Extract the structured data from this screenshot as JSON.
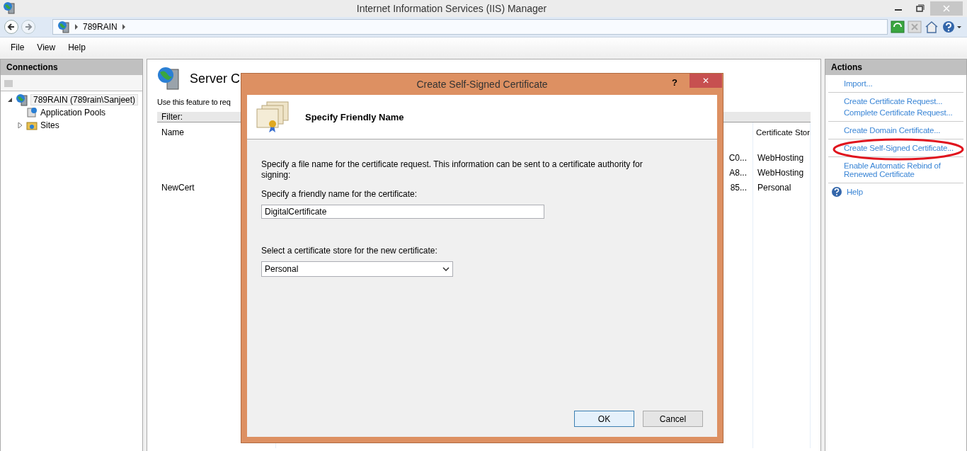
{
  "window": {
    "title": "Internet Information Services (IIS) Manager"
  },
  "address": {
    "path": [
      "789RAIN"
    ]
  },
  "menu": [
    "File",
    "View",
    "Help"
  ],
  "connections": {
    "title": "Connections",
    "tree": [
      {
        "label": "789RAIN (789rain\\Sanjeet)",
        "selected": true,
        "expanded": true,
        "children": [
          {
            "label": "Application Pools",
            "kind": "pools",
            "selected": false
          },
          {
            "label": "Sites",
            "kind": "sites",
            "selected": false,
            "expanded": false
          }
        ]
      }
    ]
  },
  "feature": {
    "title": "Server C",
    "description": "Use this feature to req",
    "filter_label": "Filter:",
    "columns": [
      "Name",
      "Certificate Stor"
    ],
    "rows": [
      {
        "name": "",
        "column_2": "C0...",
        "store": "WebHosting"
      },
      {
        "name": "",
        "column_2": "A8...",
        "store": "WebHosting"
      },
      {
        "name": "NewCert",
        "column_2": "85...",
        "store": "Personal"
      }
    ]
  },
  "actions": {
    "title": "Actions",
    "groups": [
      [
        {
          "label": "Import...",
          "kind": "link",
          "highlighted": false
        }
      ],
      [
        {
          "label": "Create Certificate Request...",
          "kind": "link",
          "highlighted": false
        },
        {
          "label": "Complete Certificate Request...",
          "kind": "link",
          "highlighted": false
        }
      ],
      [
        {
          "label": "Create Domain Certificate...",
          "kind": "link",
          "highlighted": false
        }
      ],
      [
        {
          "label": "Create Self-Signed Certificate...",
          "kind": "link",
          "highlighted": true
        }
      ],
      [
        {
          "label": "Enable Automatic Rebind of Renewed Certificate",
          "kind": "link",
          "highlighted": false
        }
      ],
      [
        {
          "label": "Help",
          "kind": "help"
        }
      ]
    ]
  },
  "dialog": {
    "title": "Create Self-Signed Certificate",
    "help": "?",
    "close": "✕",
    "heading": "Specify Friendly Name",
    "description": "Specify a file name for the certificate request.  This information can be sent to a certificate authority for signing:",
    "name_label": "Specify a friendly name for the certificate:",
    "name_value": "DigitalCertificate",
    "store_label": "Select a certificate store for the new certificate:",
    "store_value": "Personal",
    "buttons": [
      {
        "label": "OK",
        "default": true
      },
      {
        "label": "Cancel",
        "default": false
      }
    ]
  }
}
